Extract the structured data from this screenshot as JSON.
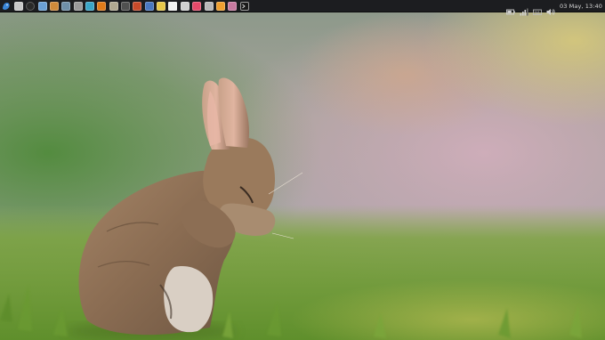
{
  "panel": {
    "launchers": [
      {
        "icon": "app-menu-icon",
        "color": "#3a86d8"
      },
      {
        "icon": "file-manager-icon",
        "color": "#c8c8c8"
      },
      {
        "icon": "system-monitor-icon",
        "color": "#2a2a2a"
      },
      {
        "icon": "photo-viewer-icon",
        "color": "#6aa0d6"
      },
      {
        "icon": "image-editor-icon",
        "color": "#d08a3a"
      },
      {
        "icon": "screenshot-icon",
        "color": "#6f8fa8"
      },
      {
        "icon": "media-player-icon",
        "color": "#9a9a9a"
      },
      {
        "icon": "messenger-icon",
        "color": "#3aa6c8"
      },
      {
        "icon": "vlc-icon",
        "color": "#e07b1a"
      },
      {
        "icon": "archive-manager-icon",
        "color": "#b0a890"
      },
      {
        "icon": "camera-icon",
        "color": "#505050"
      },
      {
        "icon": "browser-icon",
        "color": "#c84a2a"
      },
      {
        "icon": "email-icon",
        "color": "#4a78c0"
      },
      {
        "icon": "notes-icon",
        "color": "#e8c84a"
      },
      {
        "icon": "document-icon",
        "color": "#f2f2f2"
      },
      {
        "icon": "office-suite-icon",
        "color": "#d0d0d0"
      },
      {
        "icon": "web-browser-icon",
        "color": "#e84a6a"
      },
      {
        "icon": "text-editor-icon",
        "color": "#b8b8b8"
      },
      {
        "icon": "package-manager-icon",
        "color": "#f0a030"
      },
      {
        "icon": "graphics-icon",
        "color": "#c87aa0"
      },
      {
        "icon": "terminal-icon",
        "color": "#1a1a1a"
      }
    ],
    "tray": {
      "battery_icon": "battery-icon",
      "signal_icon": "signal-icon",
      "keyboard_icon": "keyboard-icon",
      "volume_icon": "volume-icon"
    },
    "clock": "03 May, 13:40"
  },
  "wallpaper": {
    "subject": "rabbit-covering-face-icon",
    "colors": {
      "grass": "#6e9a3a",
      "sky_top": "#9aa098",
      "pink_glow": "#c9a8b6"
    }
  }
}
